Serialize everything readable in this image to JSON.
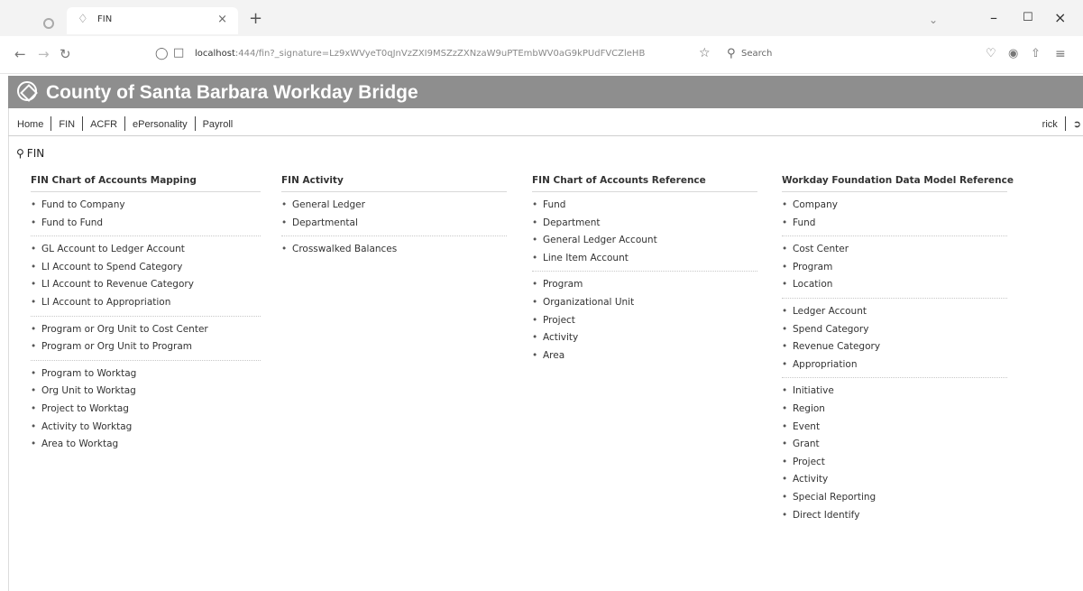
{
  "browser": {
    "tab_title": "FIN",
    "url_host": "localhost",
    "url_rest": ":444/fin?_signature=Lz9xWVyeT0qJnVzZXI9MSZzZXNzaW9uPTEmbWV0aG9kPUdFVCZleHB",
    "search_label": "Search"
  },
  "header": {
    "title": "County of Santa Barbara Workday Bridge"
  },
  "menu": {
    "items": [
      "Home",
      "FIN",
      "ACFR",
      "ePersonality",
      "Payroll"
    ],
    "user": "rick"
  },
  "page": {
    "heading": "FIN"
  },
  "columns": [
    {
      "title": "FIN Chart of Accounts Mapping",
      "groups": [
        [
          "Fund to Company",
          "Fund to Fund"
        ],
        [
          "GL Account to Ledger Account",
          "LI Account to Spend Category",
          "LI Account to Revenue Category",
          "LI Account to Appropriation"
        ],
        [
          "Program or Org Unit to Cost Center",
          "Program or Org Unit to Program"
        ],
        [
          "Program to Worktag",
          "Org Unit to Worktag",
          "Project to Worktag",
          "Activity to Worktag",
          "Area to Worktag"
        ]
      ]
    },
    {
      "title": "FIN Activity",
      "groups": [
        [
          "General Ledger",
          "Departmental"
        ],
        [
          "Crosswalked Balances"
        ]
      ]
    },
    {
      "title": "FIN Chart of Accounts Reference",
      "groups": [
        [
          "Fund",
          "Department",
          "General Ledger Account",
          "Line Item Account"
        ],
        [
          "Program",
          "Organizational Unit",
          "Project",
          "Activity",
          "Area"
        ]
      ]
    },
    {
      "title": "Workday Foundation Data Model Reference",
      "groups": [
        [
          "Company",
          "Fund"
        ],
        [
          "Cost Center",
          "Program",
          "Location"
        ],
        [
          "Ledger Account",
          "Spend Category",
          "Revenue Category",
          "Appropriation"
        ],
        [
          "Initiative",
          "Region",
          "Event",
          "Grant",
          "Project",
          "Activity",
          "Special Reporting",
          "Direct Identify"
        ]
      ]
    }
  ]
}
